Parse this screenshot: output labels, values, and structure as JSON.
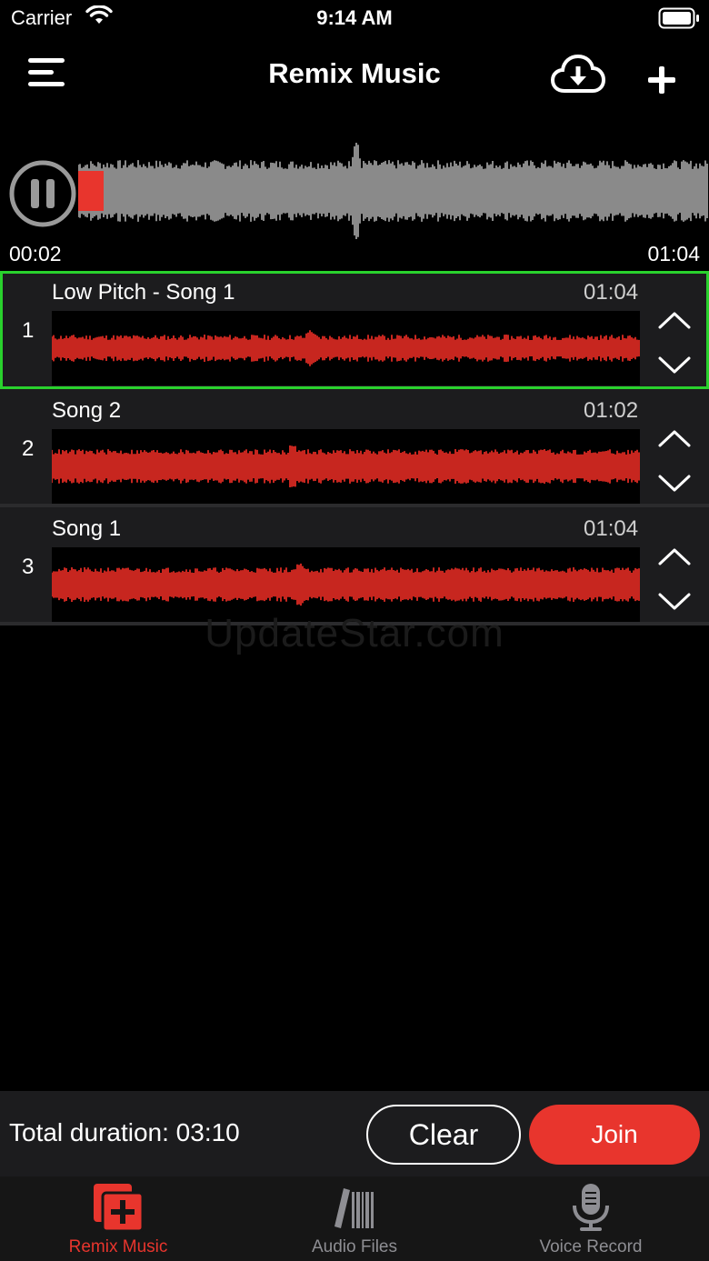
{
  "status_bar": {
    "carrier": "Carrier",
    "time": "9:14 AM"
  },
  "nav": {
    "title": "Remix Music"
  },
  "player": {
    "current_time": "00:02",
    "total_time": "01:04",
    "progress": 0.04
  },
  "tracks": [
    {
      "index": "1",
      "name": "Low Pitch - Song 1",
      "duration": "01:04",
      "selected": true
    },
    {
      "index": "2",
      "name": "Song 2",
      "duration": "01:02",
      "selected": false
    },
    {
      "index": "3",
      "name": "Song 1",
      "duration": "01:04",
      "selected": false
    }
  ],
  "watermark": "UpdateStar.com",
  "footer": {
    "total_label": "Total duration: 03:10",
    "clear_label": "Clear",
    "join_label": "Join"
  },
  "tabs": [
    {
      "label": "Remix Music",
      "icon": "remix-icon",
      "active": true
    },
    {
      "label": "Audio Files",
      "icon": "library-icon",
      "active": false
    },
    {
      "label": "Voice Record",
      "icon": "microphone-icon",
      "active": false
    }
  ],
  "colors": {
    "accent": "#e8352d",
    "selected_border": "#29d12d",
    "wave_played": "#e8352d",
    "wave_unplayed": "#8a8a8a",
    "track_wave": "#c7261f"
  }
}
